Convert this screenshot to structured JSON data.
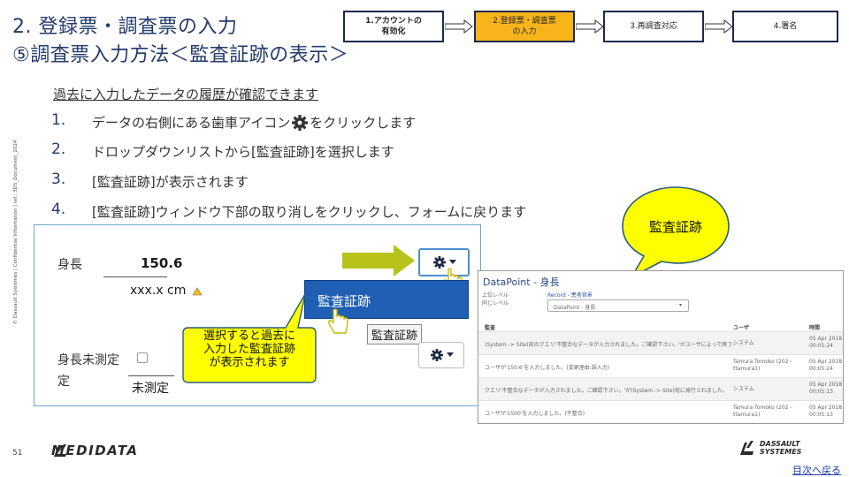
{
  "title": {
    "line1": "2. 登録票・調査票の入力",
    "line2": "⑤調査票入力方法＜監査証跡の表示＞"
  },
  "steps": [
    {
      "line1": "1.アカウントの",
      "line2": "有効化"
    },
    {
      "line1": "2.登録票・調査票",
      "line2": "の入力"
    },
    {
      "line1": "3.再調査対応",
      "line2": ""
    },
    {
      "line1": "4.署名",
      "line2": ""
    }
  ],
  "intro": "過去に入力したデータの履歴が確認できます",
  "list": [
    {
      "num": "1.",
      "before": "データの右側にある歯車アイコン",
      "after": "をクリックします"
    },
    {
      "num": "2.",
      "text": "ドロップダウンリストから[監査証跡]を選択します"
    },
    {
      "num": "3.",
      "text": "[監査証跡]が表示されます"
    },
    {
      "num": "4.",
      "text": "[監査証跡]ウィンドウ下部の取り消しをクリックし、フォームに戻ります"
    }
  ],
  "side_copyright": "© Dassault Systèmes | Confidential Information | ref.: 3DS_Document_2024",
  "form": {
    "height_label": "身長",
    "height_value": "150.6",
    "height_unit": "xxx.x cm",
    "dropdown_item": "監査証跡",
    "tooltip": "監査証跡",
    "unmeasured_label": "身長未測定",
    "unmeasured_label_2": "定",
    "unmeasured_checkbox_label": "未測定"
  },
  "callout_yellow": {
    "line1": "選択すると過去に",
    "line2": "入力した監査証跡",
    "line3": "が表示されます"
  },
  "bubble": "監査証跡",
  "datapoint": {
    "title_prefix": "DataPoint - ",
    "title_suffix": "身長",
    "upper_level_label": "上位レベル",
    "same_level_label": "同じレベル",
    "record_link": "Record - 患者背景",
    "select_value": "DataPoint - 身長",
    "columns": [
      "監査",
      "ユーザ",
      "時間"
    ],
    "rows": [
      {
        "audit": "(System -> Site)宛のクエリ'不整合なデータが入力されました。ご確認下さい。'がユーザによって終了されました。",
        "user": "システム",
        "time1": "05 Apr 2018",
        "time2": "00:05:24"
      },
      {
        "audit": "ユーザが'150.6'を入力しました。(変更理由:誤入力)",
        "user": "Tamura Tomoko (202 - ttamura1)",
        "time1": "05 Apr 2018",
        "time2": "00:05:24"
      },
      {
        "audit": "クエリ'不整合なデータが入力されました。ご確認下さい。'が(System -> Site)宛に発行されました。",
        "user": "システム",
        "time1": "05 Apr 2018",
        "time2": "00:05:13"
      },
      {
        "audit": "ユーザが'1500'を入力しました。(不整合)",
        "user": "Tamura Tomoko (202 - ttamura1)",
        "time1": "05 Apr 2018",
        "time2": "00:05:13"
      }
    ]
  },
  "footer": {
    "page_number": "51",
    "medidata": "MEDIDATA",
    "dassault_line1": "DASSAULT",
    "dassault_line2": "SYSTEMES",
    "toc_link": "目次へ戻る"
  },
  "colors": {
    "title": "#233a6b",
    "active_step": "#f7b41b",
    "callout": "#ffff00",
    "arrow": "#b7c21a",
    "dropdown": "#1f5fb4"
  }
}
